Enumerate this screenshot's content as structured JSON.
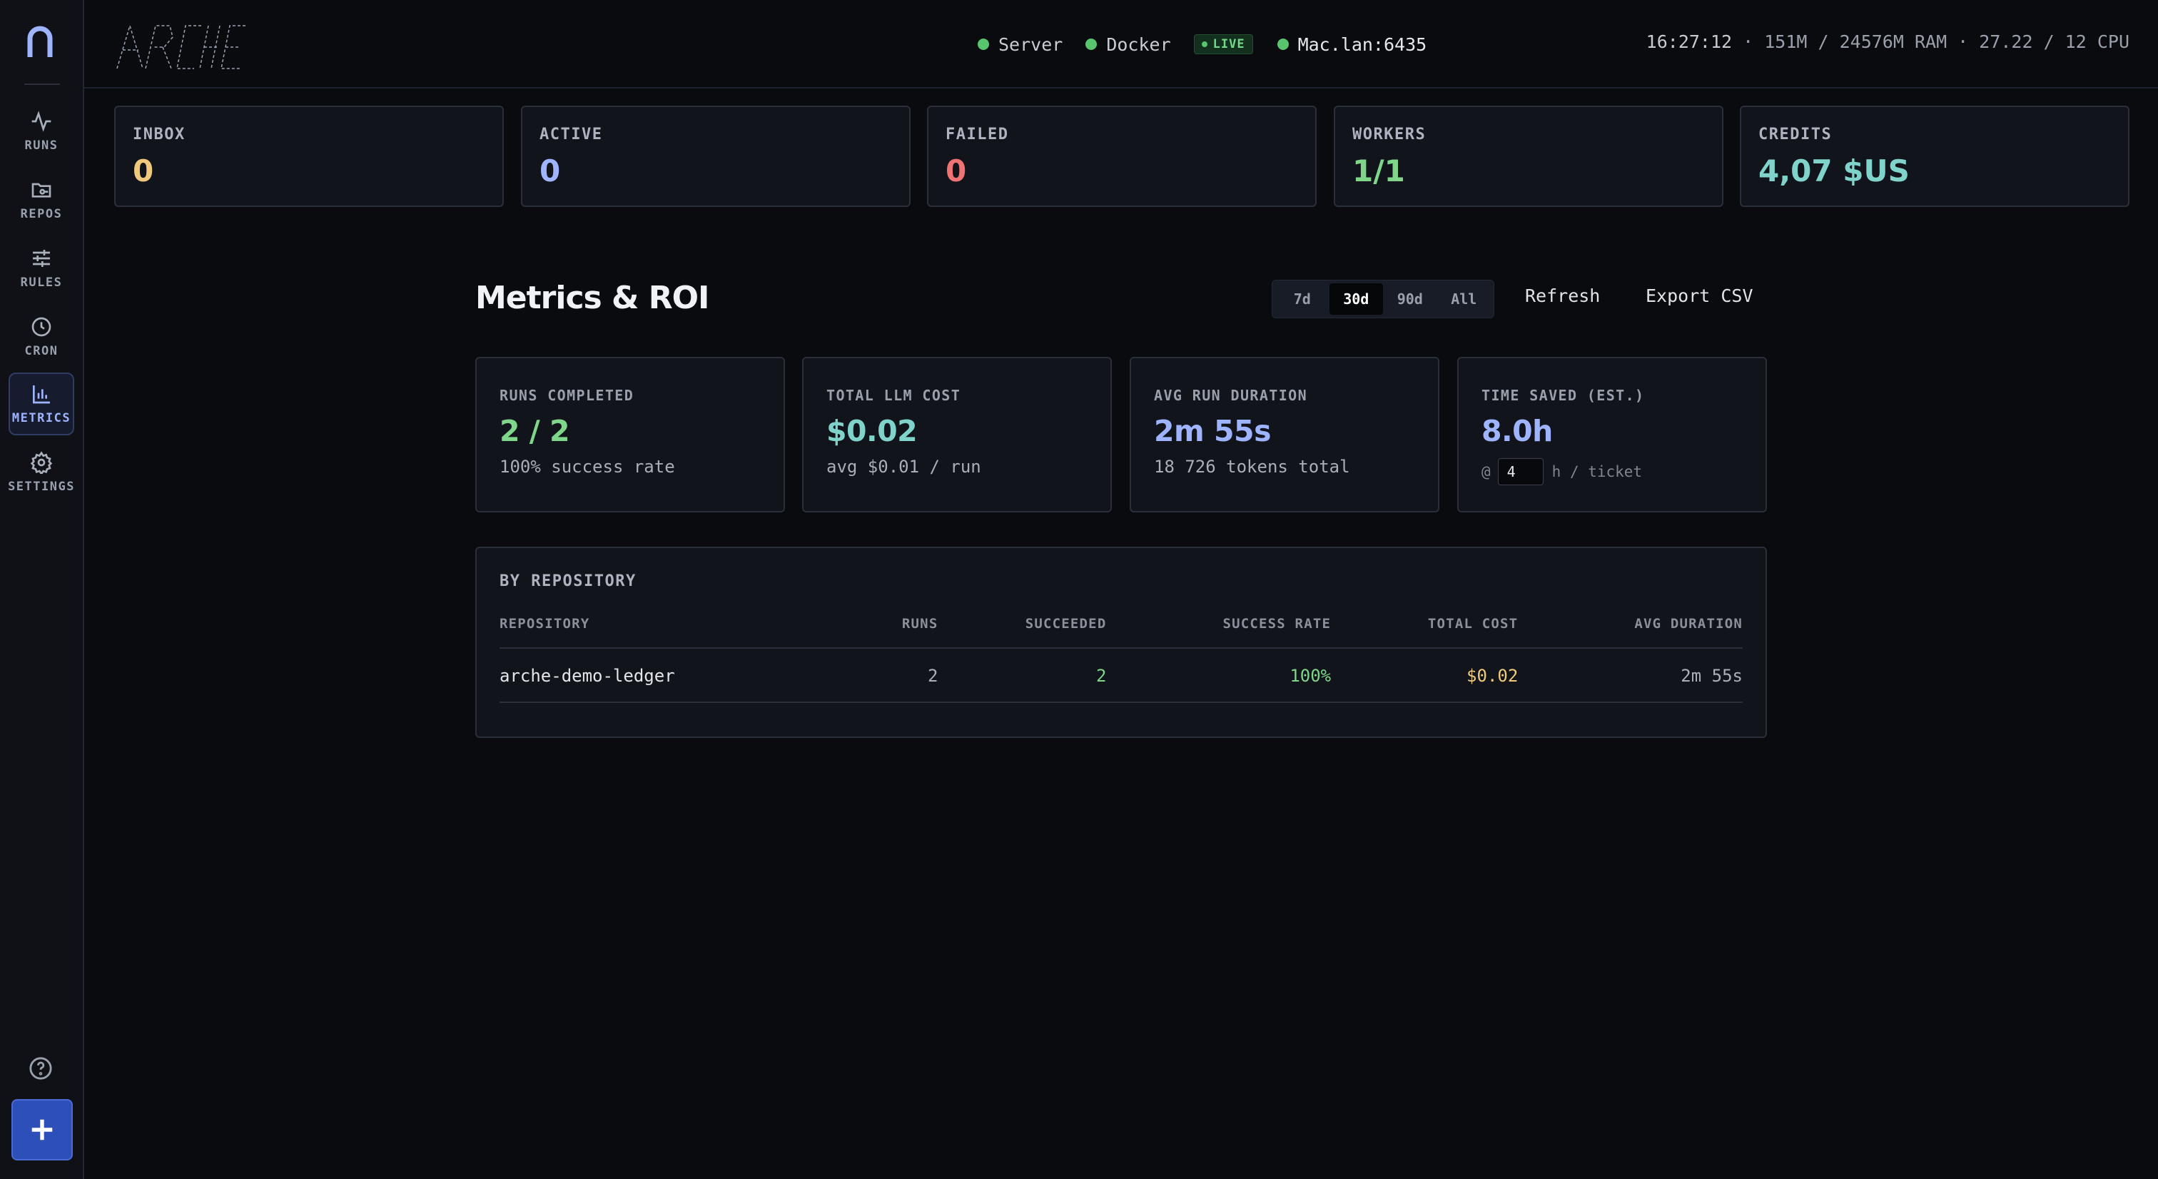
{
  "brand": {
    "name": "ARCHE"
  },
  "colors": {
    "accent": "#9fb4ff",
    "success": "#7fd68b",
    "warning": "#f0c97c",
    "danger": "#f07373",
    "teal": "#7fd3cb",
    "primary_button": "#2d4fb8"
  },
  "sidebar": {
    "items": [
      {
        "label": "RUNS",
        "icon": "activity-icon"
      },
      {
        "label": "REPOS",
        "icon": "folder-git-icon"
      },
      {
        "label": "RULES",
        "icon": "sliders-icon"
      },
      {
        "label": "CRON",
        "icon": "clock-icon"
      },
      {
        "label": "METRICS",
        "icon": "bar-chart-icon",
        "active": true
      },
      {
        "label": "SETTINGS",
        "icon": "gear-icon"
      }
    ],
    "bottom_icons": [
      "help-icon",
      "plus-icon"
    ]
  },
  "topbar": {
    "server": "Server",
    "docker": "Docker",
    "live": "LIVE",
    "host": "Mac.lan:6435",
    "time": "16:27:12",
    "sysinfo": " · 151M / 24576M RAM · 27.22 / 12 CPU"
  },
  "stats": [
    {
      "label": "INBOX",
      "value": "0",
      "color": "#f0c97c"
    },
    {
      "label": "ACTIVE",
      "value": "0",
      "color": "#9fb4ff"
    },
    {
      "label": "FAILED",
      "value": "0",
      "color": "#f07373"
    },
    {
      "label": "WORKERS",
      "value": "1/1",
      "color": "#7fd68b"
    },
    {
      "label": "CREDITS",
      "value": "4,07 $US",
      "color": "#7fd3cb"
    }
  ],
  "page": {
    "title": "Metrics & ROI",
    "ranges": [
      "7d",
      "30d",
      "90d",
      "All"
    ],
    "selected_range": "30d",
    "refresh": "Refresh",
    "export": "Export CSV"
  },
  "metrics": {
    "runs_completed": {
      "label": "RUNS COMPLETED",
      "value": "2 / 2",
      "sub": "100% success rate"
    },
    "total_cost": {
      "label": "TOTAL LLM COST",
      "value": "$0.02",
      "sub": "avg $0.01 / run"
    },
    "avg_duration": {
      "label": "AVG RUN DURATION",
      "value": "2m 55s",
      "sub": "18 726 tokens total"
    },
    "time_saved": {
      "label": "TIME SAVED (EST.)",
      "value": "8.0h",
      "prefix": "@",
      "hours_per_ticket": "4",
      "suffix": "h / ticket"
    }
  },
  "by_repo": {
    "title": "BY REPOSITORY",
    "columns": [
      "REPOSITORY",
      "RUNS",
      "SUCCEEDED",
      "SUCCESS RATE",
      "TOTAL COST",
      "AVG DURATION"
    ],
    "rows": [
      {
        "repository": "arche-demo-ledger",
        "runs": "2",
        "succeeded": "2",
        "success_rate": "100%",
        "total_cost": "$0.02",
        "avg_duration": "2m 55s"
      }
    ]
  }
}
